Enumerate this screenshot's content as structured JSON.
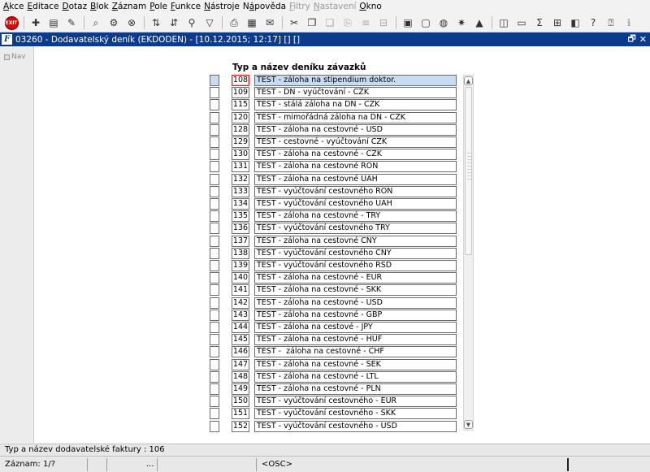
{
  "menu": [
    {
      "label": "Akce",
      "u": "A",
      "disabled": false
    },
    {
      "label": "Editace",
      "u": "E",
      "disabled": false
    },
    {
      "label": "Dotaz",
      "u": "D",
      "disabled": false
    },
    {
      "label": "Blok",
      "u": "B",
      "disabled": false
    },
    {
      "label": "Záznam",
      "u": "Z",
      "disabled": false
    },
    {
      "label": "Pole",
      "u": "P",
      "disabled": false
    },
    {
      "label": "Funkce",
      "u": "F",
      "disabled": false
    },
    {
      "label": "Nástroje",
      "u": "N",
      "disabled": false
    },
    {
      "label": "Nápověda",
      "u": "á",
      "disabled": false
    },
    {
      "label": "Filtry",
      "u": "F",
      "disabled": true
    },
    {
      "label": "Nastavení",
      "u": "N",
      "disabled": true
    },
    {
      "label": "Okno",
      "u": "O",
      "disabled": false
    }
  ],
  "toolbar": {
    "exit_label": "EXIT"
  },
  "window": {
    "title": "03260 - Dodavatelský deník (EKDODEN) - [10.12.2015; 12:17] [] []",
    "app_icon": "F",
    "restore_glyph": "🗗",
    "close_glyph": "✕"
  },
  "nav": {
    "label": "Nav"
  },
  "grid": {
    "header": "Typ a název deníku závazků",
    "rows": [
      {
        "code": "108",
        "name": "TEST - záloha na stipendium doktor."
      },
      {
        "code": "109",
        "name": "TEST - DN - vyúčtování - CZK"
      },
      {
        "code": "115",
        "name": "TEST - stálá záloha na DN - CZK"
      },
      {
        "code": "120",
        "name": "TEST - mimořádná záloha na DN - CZK"
      },
      {
        "code": "128",
        "name": "TEST - záloha na cestovné - USD"
      },
      {
        "code": "129",
        "name": "TEST - cestovné - vyúčtování CZK"
      },
      {
        "code": "130",
        "name": "TEST - záloha na cestovné - CZK"
      },
      {
        "code": "131",
        "name": "TEST - záloha na cestovné RON"
      },
      {
        "code": "132",
        "name": "TEST - záloha na cestovné UAH"
      },
      {
        "code": "133",
        "name": "TEST - vyúčtování cestovného RON"
      },
      {
        "code": "134",
        "name": "TEST - vyúčtování cestovného UAH"
      },
      {
        "code": "135",
        "name": "TEST - záloha na cestovné - TRY"
      },
      {
        "code": "136",
        "name": "TEST - vyúčtování cestovného TRY"
      },
      {
        "code": "137",
        "name": "TEST - záloha na cestovné CNY"
      },
      {
        "code": "138",
        "name": "TEST - vyúčtování cestovného CNY"
      },
      {
        "code": "139",
        "name": "TEST - vyúčtování cestovného RSD"
      },
      {
        "code": "140",
        "name": "TEST - záloha na cestovné - EUR"
      },
      {
        "code": "141",
        "name": "TEST - záloha na cestovné - SKK"
      },
      {
        "code": "142",
        "name": "TEST - záloha na cestovné - USD"
      },
      {
        "code": "143",
        "name": "TEST - záloha na cestovné - GBP"
      },
      {
        "code": "144",
        "name": "TEST - záloha na cestové - JPY"
      },
      {
        "code": "145",
        "name": "TEST - záloha na cestovné - HUF"
      },
      {
        "code": "146",
        "name": "TEST -  záloha na cestovné - CHF"
      },
      {
        "code": "147",
        "name": "TEST - záloha na cestovné - SEK"
      },
      {
        "code": "148",
        "name": "TEST - záloha na cestovné - LTL"
      },
      {
        "code": "149",
        "name": "TEST - záloha na cestovné - PLN"
      },
      {
        "code": "150",
        "name": "TEST - vyúčtování cestovného - EUR"
      },
      {
        "code": "151",
        "name": "TEST - vyúčtování cestovného - SKK"
      },
      {
        "code": "152",
        "name": "TEST - vyúčtování cestovného - USD"
      }
    ]
  },
  "status": {
    "hint": "Typ a název dodavatelské faktury : 106",
    "record": "Záznam: 1/?",
    "ellipsis": "...",
    "mode": "<OSC>"
  }
}
